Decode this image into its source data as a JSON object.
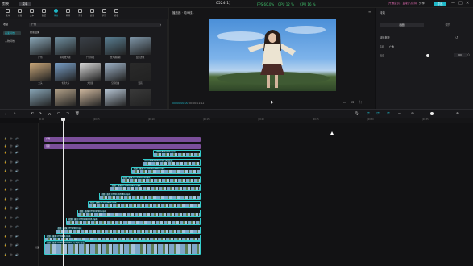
{
  "titlebar": {
    "app_name": "剪映",
    "menu_label": "菜单",
    "window_title": "0524(1)",
    "perf": {
      "fps": "FPS 60.0%",
      "gpu": "GPU 12 %",
      "cpu": "CPU 16 %"
    },
    "member": "开通会员，复制八成特",
    "share": "分享",
    "export": "导出",
    "win_controls": [
      "—",
      "□",
      "✕"
    ]
  },
  "toolbar": {
    "items": [
      {
        "label": "媒体",
        "icon": "media-icon"
      },
      {
        "label": "音频",
        "icon": "audio-icon"
      },
      {
        "label": "文本",
        "icon": "text-icon"
      },
      {
        "label": "贴纸",
        "icon": "sticker-icon"
      },
      {
        "label": "特效",
        "icon": "effects-icon",
        "active": true
      },
      {
        "label": "转场",
        "icon": "transition-icon"
      },
      {
        "label": "字幕",
        "icon": "subtitle-icon"
      },
      {
        "label": "滤镜",
        "icon": "filter-icon"
      },
      {
        "label": "调节",
        "icon": "adjust-icon"
      },
      {
        "label": "模板",
        "icon": "template-icon"
      }
    ]
  },
  "left_panel": {
    "category_select": "收藏",
    "search_value": "广角",
    "categories": [
      {
        "label": "画面特效",
        "active": true
      },
      {
        "label": "人物特效",
        "active": false
      }
    ],
    "section_title": "搜索结果",
    "thumbs": [
      {
        "caption": "广角",
        "color": "#8aa7b8"
      },
      {
        "caption": "鱼眼放大镜",
        "color": "#6f8fa0"
      },
      {
        "caption": "广角鱼眼",
        "color": "#3a4048"
      },
      {
        "caption": "放大镜模糊",
        "color": "#5a7f93"
      },
      {
        "caption": "变形透镜",
        "color": "#7f96a8"
      },
      {
        "caption": "大头",
        "color": "#c9a77a"
      },
      {
        "caption": "卡通大头",
        "color": "#7aa0c8"
      },
      {
        "caption": "大长腿",
        "color": "#d9d9d9"
      },
      {
        "caption": "空间扭曲",
        "color": "#9fb3c8"
      },
      {
        "caption": "漫画",
        "color": "#2a2a2a"
      },
      {
        "caption": "",
        "color": "#8aa7b8"
      },
      {
        "caption": "",
        "color": "#b3a28a"
      },
      {
        "caption": "",
        "color": "#d0b9a0"
      },
      {
        "caption": "",
        "color": "#b8c7d6"
      },
      {
        "caption": "",
        "color": "#3a3a3a"
      }
    ]
  },
  "player": {
    "title": "播放器 · 时间线1",
    "timecode_current": "00:00:00:00",
    "timecode_total": "00:00:01:22"
  },
  "props": {
    "tab_label": "特效",
    "sub_tabs": [
      "画面",
      "调节"
    ],
    "section": "特效参数",
    "name_label": "名称",
    "name_value": "广角",
    "intensity_label": "强度",
    "intensity_value": 60
  },
  "timeline": {
    "ruler_ticks": [
      "00:00",
      "|00:05",
      "|00:10",
      "|00:15",
      "|00:20",
      "|00:25",
      "|00:30",
      "|00:35",
      "|00:40"
    ],
    "effect_tracks": [
      {
        "label": "广角"
      },
      {
        "label": "晕影"
      }
    ],
    "clips": [
      {
        "label": "CTTFG8940060.mp4"
      },
      {
        "label": "CTTFG8940020.mp4 [2] 复制"
      },
      {
        "label": "视频 · 抠像 CTT00040-4400.mp4"
      },
      {
        "label": "视频 · 抠像 CTT3450-64.mp4"
      },
      {
        "label": "视频 · 抠像 CTT00071012.mp4"
      },
      {
        "label": "视频 · 抠像 CTT01067089.mp4"
      },
      {
        "label": "视频 · 抠像 CTT019003.mp4"
      },
      {
        "label": "视频 · 抠像 CTT002500.mp4"
      },
      {
        "label": "视频 · 抠像 CTT01020003.mp4"
      },
      {
        "label": "视频 · 抠像 CTT1200.mp4"
      },
      {
        "label": "视频 · 抠像 CTT0600.mp4"
      }
    ],
    "main_track": {
      "cover": "封面",
      "label": "视频 · 抠像 CTTFG8940060.mp4 [1] 主轨"
    }
  }
}
